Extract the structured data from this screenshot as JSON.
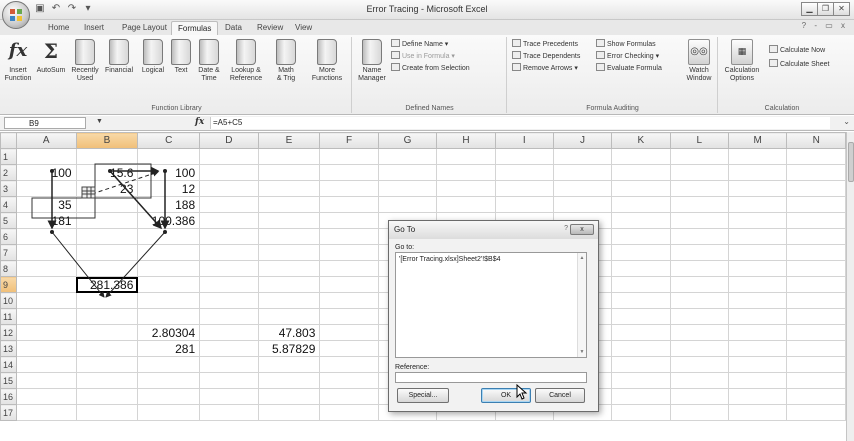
{
  "app": {
    "title": "Error Tracing - Microsoft Excel",
    "office_button": "",
    "window_controls": [
      "▭",
      "▭",
      "✕"
    ]
  },
  "ribbon_tabs": [
    {
      "label": "Home",
      "active": false
    },
    {
      "label": "Insert",
      "active": false
    },
    {
      "label": "Page Layout",
      "active": false
    },
    {
      "label": "Formulas",
      "active": true
    },
    {
      "label": "Data",
      "active": false
    },
    {
      "label": "Review",
      "active": false
    },
    {
      "label": "View",
      "active": false
    }
  ],
  "help_area": "? - ▭ x",
  "ribbon": {
    "function_library": {
      "label": "Function Library",
      "insert_function": "Insert\nFunction",
      "autosum": "AutoSum",
      "recently_used": "Recently\nUsed",
      "financial": "Financial",
      "logical": "Logical",
      "text": "Text",
      "date_time": "Date &\nTime",
      "lookup_reference": "Lookup &\nReference",
      "math_trig": "Math\n& Trig",
      "more_functions": "More\nFunctions"
    },
    "defined_names": {
      "label": "Defined Names",
      "name_manager": "Name\nManager",
      "define_name": "Define Name",
      "use_in_formula": "Use in Formula",
      "create_from_selection": "Create from Selection"
    },
    "formula_auditing": {
      "label": "Formula Auditing",
      "trace_precedents": "Trace Precedents",
      "trace_dependents": "Trace Dependents",
      "remove_arrows": "Remove Arrows",
      "show_formulas": "Show Formulas",
      "error_checking": "Error Checking",
      "evaluate_formula": "Evaluate Formula",
      "watch_window": "Watch\nWindow"
    },
    "calculation": {
      "label": "Calculation",
      "calculation_options": "Calculation\nOptions",
      "calculate_now": "Calculate Now",
      "calculate_sheet": "Calculate Sheet"
    }
  },
  "formula_bar": {
    "name_box": "B9",
    "fx": "fx",
    "formula": "=A5+C5"
  },
  "columns": [
    "A",
    "B",
    "C",
    "D",
    "E",
    "F",
    "G",
    "H",
    "I",
    "J",
    "K",
    "L",
    "M",
    "N"
  ],
  "selected_column": "B",
  "selected_row": "9",
  "rows": [
    {
      "n": "1",
      "cells": {}
    },
    {
      "n": "2",
      "cells": {
        "A": "100",
        "B": "15.6",
        "C": "100"
      }
    },
    {
      "n": "3",
      "cells": {
        "B": "23",
        "C": "12"
      }
    },
    {
      "n": "4",
      "cells": {
        "A": "35",
        "C": "188"
      }
    },
    {
      "n": "5",
      "cells": {
        "A": "181",
        "C": "100.386"
      }
    },
    {
      "n": "6",
      "cells": {}
    },
    {
      "n": "7",
      "cells": {}
    },
    {
      "n": "8",
      "cells": {}
    },
    {
      "n": "9",
      "cells": {
        "B": "281.386"
      }
    },
    {
      "n": "10",
      "cells": {}
    },
    {
      "n": "11",
      "cells": {}
    },
    {
      "n": "12",
      "cells": {
        "C": "2.80304",
        "E": "47.803"
      }
    },
    {
      "n": "13",
      "cells": {
        "C": "281",
        "E": "5.87829"
      }
    },
    {
      "n": "14",
      "cells": {}
    },
    {
      "n": "15",
      "cells": {}
    },
    {
      "n": "16",
      "cells": {}
    },
    {
      "n": "17",
      "cells": {}
    }
  ],
  "goto_dialog": {
    "title": "Go To",
    "help": "?",
    "close": "x",
    "go_to_label": "Go to:",
    "list_items": [
      "'[Error Tracing.xlsx]Sheet2'!$B$4"
    ],
    "reference_label": "Reference:",
    "reference_value": "",
    "special_button": "Special...",
    "ok_button": "OK",
    "cancel_button": "Cancel"
  }
}
